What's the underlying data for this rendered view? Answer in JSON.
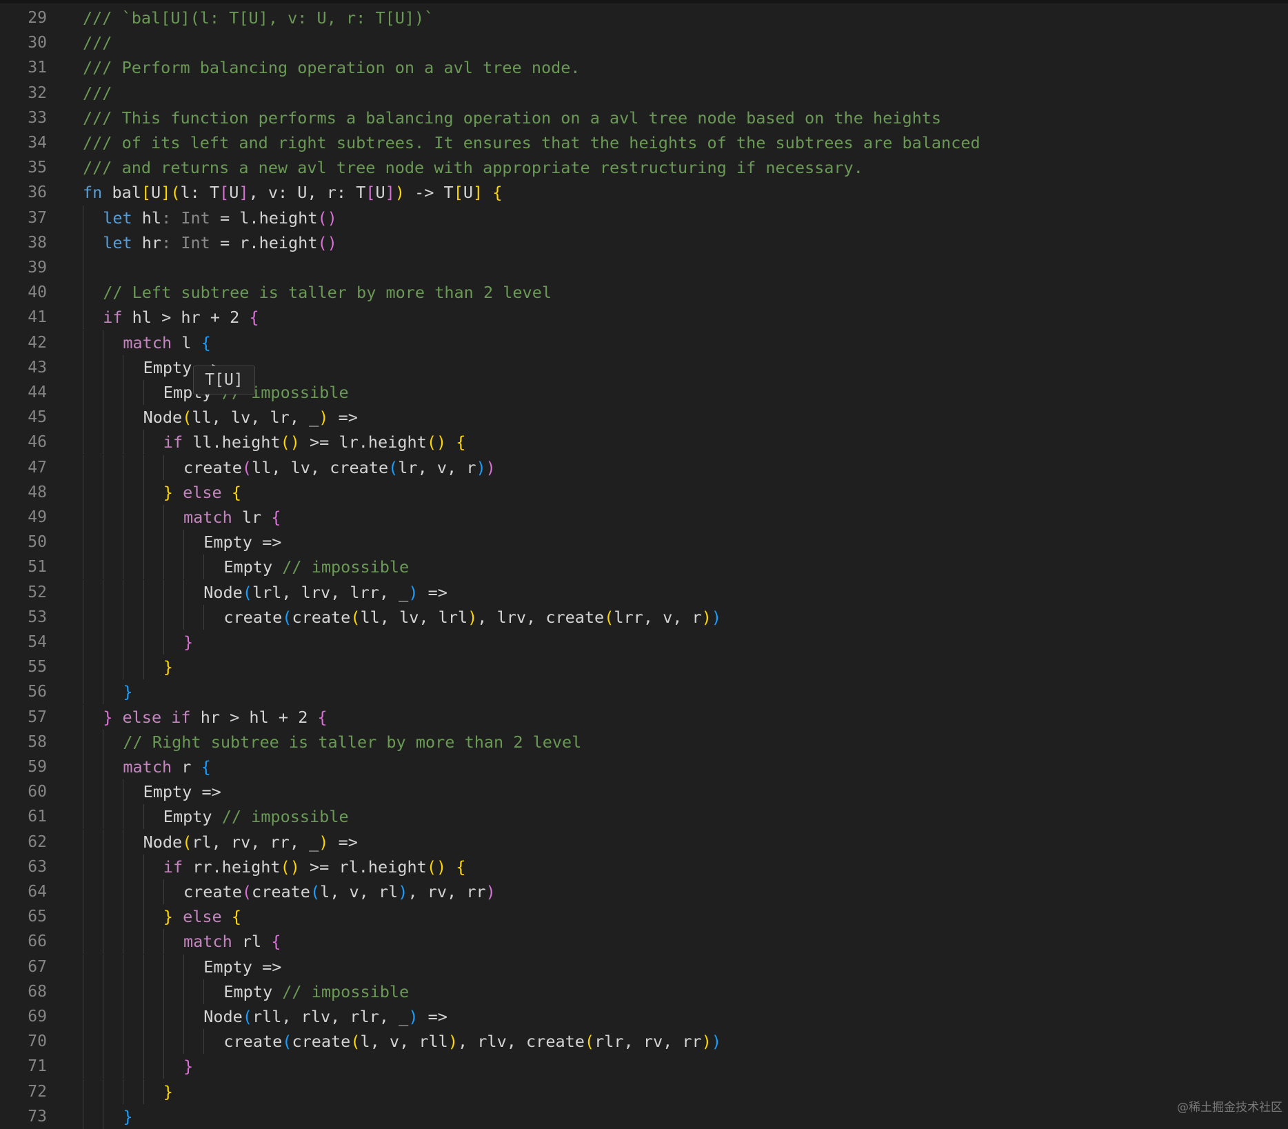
{
  "editor": {
    "tooltip": "T[U]",
    "watermark": "@稀土掘金技术社区",
    "lines": [
      {
        "n": "29",
        "indent": 0,
        "tokens": [
          [
            "c",
            "/// `bal[U](l: T[U], v: U, r: T[U])`"
          ]
        ]
      },
      {
        "n": "30",
        "indent": 0,
        "tokens": [
          [
            "c",
            "///"
          ]
        ]
      },
      {
        "n": "31",
        "indent": 0,
        "tokens": [
          [
            "c",
            "/// Perform balancing operation on a avl tree node."
          ]
        ]
      },
      {
        "n": "32",
        "indent": 0,
        "tokens": [
          [
            "c",
            "///"
          ]
        ]
      },
      {
        "n": "33",
        "indent": 0,
        "tokens": [
          [
            "c",
            "/// This function performs a balancing operation on a avl tree node based on the heights"
          ]
        ]
      },
      {
        "n": "34",
        "indent": 0,
        "tokens": [
          [
            "c",
            "/// of its left and right subtrees. It ensures that the heights of the subtrees are balanced"
          ]
        ]
      },
      {
        "n": "35",
        "indent": 0,
        "tokens": [
          [
            "c",
            "/// and returns a new avl tree node with appropriate restructuring if necessary."
          ]
        ]
      },
      {
        "n": "36",
        "indent": 0,
        "tokens": [
          [
            "k",
            "fn"
          ],
          [
            "p",
            " bal"
          ],
          [
            "y",
            "["
          ],
          [
            "p",
            "U"
          ],
          [
            "y",
            "]("
          ],
          [
            "p",
            "l: T"
          ],
          [
            "m",
            "["
          ],
          [
            "p",
            "U"
          ],
          [
            "m",
            "]"
          ],
          [
            "p",
            ", v: U, r: T"
          ],
          [
            "m",
            "["
          ],
          [
            "p",
            "U"
          ],
          [
            "m",
            "]"
          ],
          [
            "y",
            ")"
          ],
          [
            "p",
            " -> T"
          ],
          [
            "y",
            "["
          ],
          [
            "p",
            "U"
          ],
          [
            "y",
            "]"
          ],
          [
            "p",
            " "
          ],
          [
            "y",
            "{"
          ]
        ]
      },
      {
        "n": "37",
        "indent": 1,
        "tokens": [
          [
            "k",
            "let"
          ],
          [
            "p",
            " hl"
          ],
          [
            "d",
            ": Int"
          ],
          [
            "p",
            " = l.height"
          ],
          [
            "m",
            "()"
          ]
        ]
      },
      {
        "n": "38",
        "indent": 1,
        "tokens": [
          [
            "k",
            "let"
          ],
          [
            "p",
            " hr"
          ],
          [
            "d",
            ": Int"
          ],
          [
            "p",
            " = r.height"
          ],
          [
            "m",
            "()"
          ]
        ]
      },
      {
        "n": "39",
        "indent": 1,
        "tokens": []
      },
      {
        "n": "40",
        "indent": 1,
        "tokens": [
          [
            "c",
            "// Left subtree is taller by more than 2 level"
          ]
        ]
      },
      {
        "n": "41",
        "indent": 1,
        "tokens": [
          [
            "x",
            "if"
          ],
          [
            "p",
            " hl > hr + "
          ],
          [
            "p",
            "2"
          ],
          [
            "p",
            " "
          ],
          [
            "m",
            "{"
          ]
        ]
      },
      {
        "n": "42",
        "indent": 2,
        "tokens": [
          [
            "x",
            "match"
          ],
          [
            "p",
            " l "
          ],
          [
            "b",
            "{"
          ]
        ]
      },
      {
        "n": "43",
        "indent": 3,
        "tokens": [
          [
            "p",
            "Empty =>"
          ]
        ]
      },
      {
        "n": "44",
        "indent": 4,
        "tokens": [
          [
            "p",
            "Empty "
          ],
          [
            "c",
            "// impossible"
          ]
        ]
      },
      {
        "n": "45",
        "indent": 3,
        "tokens": [
          [
            "p",
            "Node"
          ],
          [
            "y",
            "("
          ],
          [
            "p",
            "ll, lv, lr, _"
          ],
          [
            "y",
            ")"
          ],
          [
            "p",
            " =>"
          ]
        ]
      },
      {
        "n": "46",
        "indent": 4,
        "tokens": [
          [
            "x",
            "if"
          ],
          [
            "p",
            " ll.height"
          ],
          [
            "y",
            "()"
          ],
          [
            "p",
            " >= lr.height"
          ],
          [
            "y",
            "()"
          ],
          [
            "p",
            " "
          ],
          [
            "y",
            "{"
          ]
        ]
      },
      {
        "n": "47",
        "indent": 5,
        "tokens": [
          [
            "p",
            "create"
          ],
          [
            "m",
            "("
          ],
          [
            "p",
            "ll, lv, create"
          ],
          [
            "b",
            "("
          ],
          [
            "p",
            "lr, v, r"
          ],
          [
            "b",
            ")"
          ],
          [
            "m",
            ")"
          ]
        ]
      },
      {
        "n": "48",
        "indent": 4,
        "tokens": [
          [
            "y",
            "}"
          ],
          [
            "p",
            " "
          ],
          [
            "x",
            "else"
          ],
          [
            "p",
            " "
          ],
          [
            "y",
            "{"
          ]
        ]
      },
      {
        "n": "49",
        "indent": 5,
        "tokens": [
          [
            "x",
            "match"
          ],
          [
            "p",
            " lr "
          ],
          [
            "m",
            "{"
          ]
        ]
      },
      {
        "n": "50",
        "indent": 6,
        "tokens": [
          [
            "p",
            "Empty =>"
          ]
        ]
      },
      {
        "n": "51",
        "indent": 7,
        "tokens": [
          [
            "p",
            "Empty "
          ],
          [
            "c",
            "// impossible"
          ]
        ]
      },
      {
        "n": "52",
        "indent": 6,
        "tokens": [
          [
            "p",
            "Node"
          ],
          [
            "b",
            "("
          ],
          [
            "p",
            "lrl, lrv, lrr, _"
          ],
          [
            "b",
            ")"
          ],
          [
            "p",
            " =>"
          ]
        ]
      },
      {
        "n": "53",
        "indent": 7,
        "tokens": [
          [
            "p",
            "create"
          ],
          [
            "b",
            "("
          ],
          [
            "p",
            "create"
          ],
          [
            "y",
            "("
          ],
          [
            "p",
            "ll, lv, lrl"
          ],
          [
            "y",
            ")"
          ],
          [
            "p",
            ", lrv, create"
          ],
          [
            "y",
            "("
          ],
          [
            "p",
            "lrr, v, r"
          ],
          [
            "y",
            ")"
          ],
          [
            "b",
            ")"
          ]
        ]
      },
      {
        "n": "54",
        "indent": 5,
        "tokens": [
          [
            "m",
            "}"
          ]
        ]
      },
      {
        "n": "55",
        "indent": 4,
        "tokens": [
          [
            "y",
            "}"
          ]
        ]
      },
      {
        "n": "56",
        "indent": 2,
        "tokens": [
          [
            "b",
            "}"
          ]
        ]
      },
      {
        "n": "57",
        "indent": 1,
        "tokens": [
          [
            "m",
            "}"
          ],
          [
            "p",
            " "
          ],
          [
            "x",
            "else if"
          ],
          [
            "p",
            " hr > hl + "
          ],
          [
            "p",
            "2"
          ],
          [
            "p",
            " "
          ],
          [
            "m",
            "{"
          ]
        ]
      },
      {
        "n": "58",
        "indent": 2,
        "tokens": [
          [
            "c",
            "// Right subtree is taller by more than 2 level"
          ]
        ]
      },
      {
        "n": "59",
        "indent": 2,
        "tokens": [
          [
            "x",
            "match"
          ],
          [
            "p",
            " r "
          ],
          [
            "b",
            "{"
          ]
        ]
      },
      {
        "n": "60",
        "indent": 3,
        "tokens": [
          [
            "p",
            "Empty =>"
          ]
        ]
      },
      {
        "n": "61",
        "indent": 4,
        "tokens": [
          [
            "p",
            "Empty "
          ],
          [
            "c",
            "// impossible"
          ]
        ]
      },
      {
        "n": "62",
        "indent": 3,
        "tokens": [
          [
            "p",
            "Node"
          ],
          [
            "y",
            "("
          ],
          [
            "p",
            "rl, rv, rr, _"
          ],
          [
            "y",
            ")"
          ],
          [
            "p",
            " =>"
          ]
        ]
      },
      {
        "n": "63",
        "indent": 4,
        "tokens": [
          [
            "x",
            "if"
          ],
          [
            "p",
            " rr.height"
          ],
          [
            "y",
            "()"
          ],
          [
            "p",
            " >= rl.height"
          ],
          [
            "y",
            "()"
          ],
          [
            "p",
            " "
          ],
          [
            "y",
            "{"
          ]
        ]
      },
      {
        "n": "64",
        "indent": 5,
        "tokens": [
          [
            "p",
            "create"
          ],
          [
            "m",
            "("
          ],
          [
            "p",
            "create"
          ],
          [
            "b",
            "("
          ],
          [
            "p",
            "l, v, rl"
          ],
          [
            "b",
            ")"
          ],
          [
            "p",
            ", rv, rr"
          ],
          [
            "m",
            ")"
          ]
        ]
      },
      {
        "n": "65",
        "indent": 4,
        "tokens": [
          [
            "y",
            "}"
          ],
          [
            "p",
            " "
          ],
          [
            "x",
            "else"
          ],
          [
            "p",
            " "
          ],
          [
            "y",
            "{"
          ]
        ]
      },
      {
        "n": "66",
        "indent": 5,
        "tokens": [
          [
            "x",
            "match"
          ],
          [
            "p",
            " rl "
          ],
          [
            "m",
            "{"
          ]
        ]
      },
      {
        "n": "67",
        "indent": 6,
        "tokens": [
          [
            "p",
            "Empty =>"
          ]
        ]
      },
      {
        "n": "68",
        "indent": 7,
        "tokens": [
          [
            "p",
            "Empty "
          ],
          [
            "c",
            "// impossible"
          ]
        ]
      },
      {
        "n": "69",
        "indent": 6,
        "tokens": [
          [
            "p",
            "Node"
          ],
          [
            "b",
            "("
          ],
          [
            "p",
            "rll, rlv, rlr, _"
          ],
          [
            "b",
            ")"
          ],
          [
            "p",
            " =>"
          ]
        ]
      },
      {
        "n": "70",
        "indent": 7,
        "tokens": [
          [
            "p",
            "create"
          ],
          [
            "b",
            "("
          ],
          [
            "p",
            "create"
          ],
          [
            "y",
            "("
          ],
          [
            "p",
            "l, v, rll"
          ],
          [
            "y",
            ")"
          ],
          [
            "p",
            ", rlv, create"
          ],
          [
            "y",
            "("
          ],
          [
            "p",
            "rlr, rv, rr"
          ],
          [
            "y",
            ")"
          ],
          [
            "b",
            ")"
          ]
        ]
      },
      {
        "n": "71",
        "indent": 5,
        "tokens": [
          [
            "m",
            "}"
          ]
        ]
      },
      {
        "n": "72",
        "indent": 4,
        "tokens": [
          [
            "y",
            "}"
          ]
        ]
      },
      {
        "n": "73",
        "indent": 2,
        "tokens": [
          [
            "b",
            "}"
          ]
        ]
      }
    ]
  }
}
